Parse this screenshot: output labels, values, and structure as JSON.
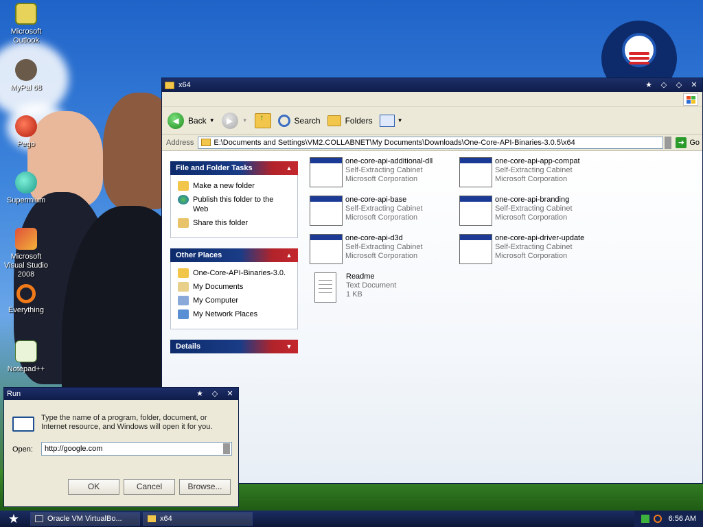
{
  "desktop": {
    "icons": [
      {
        "label": "Microsoft Outlook",
        "icon": "outlook-icon"
      },
      {
        "label": "MyPal 68",
        "icon": "mypal-icon"
      },
      {
        "label": "Pego",
        "icon": "pego-icon"
      },
      {
        "label": "Supermium",
        "icon": "supermium-icon"
      },
      {
        "label": "Microsoft Visual Studio 2008",
        "icon": "visual-studio-icon"
      },
      {
        "label": "Everything",
        "icon": "everything-icon"
      },
      {
        "label": "Notepad++",
        "icon": "notepadpp-icon"
      }
    ]
  },
  "explorer": {
    "title": "x64",
    "toolbar": {
      "back": "Back",
      "search": "Search",
      "folders": "Folders"
    },
    "address": {
      "label": "Address",
      "value": "E:\\Documents and Settings\\VM2.COLLABNET\\My Documents\\Downloads\\One-Core-API-Binaries-3.0.5\\x64",
      "go": "Go"
    },
    "panes": {
      "tasks": {
        "title": "File and Folder Tasks",
        "items": [
          "Make a new folder",
          "Publish this folder to the Web",
          "Share this folder"
        ]
      },
      "places": {
        "title": "Other Places",
        "items": [
          "One-Core-API-Binaries-3.0.",
          "My Documents",
          "My Computer",
          "My Network Places"
        ]
      },
      "details": {
        "title": "Details"
      }
    },
    "files": [
      {
        "name": "one-core-api-additional-dll",
        "type": "Self-Extracting Cabinet",
        "meta": "Microsoft Corporation"
      },
      {
        "name": "one-core-api-app-compat",
        "type": "Self-Extracting Cabinet",
        "meta": "Microsoft Corporation"
      },
      {
        "name": "one-core-api-base",
        "type": "Self-Extracting Cabinet",
        "meta": "Microsoft Corporation"
      },
      {
        "name": "one-core-api-branding",
        "type": "Self-Extracting Cabinet",
        "meta": "Microsoft Corporation"
      },
      {
        "name": "one-core-api-d3d",
        "type": "Self-Extracting Cabinet",
        "meta": "Microsoft Corporation"
      },
      {
        "name": "one-core-api-driver-update",
        "type": "Self-Extracting Cabinet",
        "meta": "Microsoft Corporation"
      },
      {
        "name": "Readme",
        "type": "Text Document",
        "meta": "1 KB"
      }
    ]
  },
  "run": {
    "title": "Run",
    "description": "Type the name of a program, folder, document, or Internet resource, and Windows will open it for you.",
    "open_label": "Open:",
    "open_value": "http://google.com",
    "ok": "OK",
    "cancel": "Cancel",
    "browse": "Browse..."
  },
  "taskbar": {
    "items": [
      "Oracle VM VirtualBo...",
      "x64"
    ],
    "clock": "6:56 AM"
  }
}
